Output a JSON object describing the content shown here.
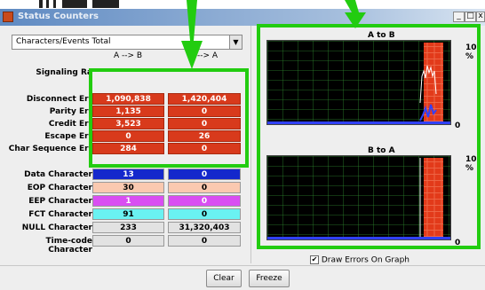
{
  "window": {
    "title": "Status Counters",
    "controls": [
      "_",
      "□",
      "x"
    ]
  },
  "selector": {
    "value": "Characters/Events Total"
  },
  "columns": {
    "a": "A --> B",
    "b": "B --> A"
  },
  "rows": [
    {
      "label": "Signaling Ra",
      "a": "",
      "b": ""
    },
    {
      "label": "Disconnect Err",
      "a": "1,090,838",
      "b": "1,420,404"
    },
    {
      "label": "Parity Err",
      "a": "1,135",
      "b": "0"
    },
    {
      "label": "Credit Err",
      "a": "3,523",
      "b": "0"
    },
    {
      "label": "Escape Err",
      "a": "0",
      "b": "26"
    },
    {
      "label": "Char Sequence Err",
      "a": "284",
      "b": "0"
    },
    {
      "label": "Data Character",
      "a": "13",
      "b": "0"
    },
    {
      "label": "EOP Character",
      "a": "30",
      "b": "0"
    },
    {
      "label": "EEP Character",
      "a": "1",
      "b": "0"
    },
    {
      "label": "FCT Character",
      "a": "91",
      "b": "0"
    },
    {
      "label": "NULL Character",
      "a": "233",
      "b": "31,320,403"
    },
    {
      "label": "Time-code Character",
      "a": "0",
      "b": "0"
    }
  ],
  "graphs": {
    "top": {
      "title": "A to B",
      "max_label": "10 %",
      "min_label": "0"
    },
    "bottom": {
      "title": "B to A",
      "max_label": "10 %",
      "min_label": "0"
    }
  },
  "draw_errors": {
    "label": "Draw Errors On Graph",
    "checked": true,
    "mark": "✔"
  },
  "buttons": {
    "clear": "Clear",
    "freeze": "Freeze"
  },
  "colors": {
    "error_red": "#d83a1c",
    "data_blue": "#1428cc",
    "eop_peach": "#fac9b0",
    "eep_magenta": "#d94ef2",
    "fct_cyan": "#6af2f2",
    "highlight_green": "#22cc10"
  }
}
